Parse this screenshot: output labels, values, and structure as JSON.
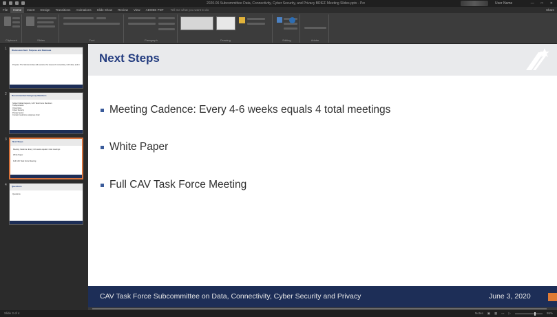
{
  "window": {
    "document_title": "2020-06 Subcommittee Data, Connectivity, Cyber Security, and Privacy BRIEF Meeting Slides.pptx - PowerPoint",
    "user_name": "User Name",
    "controls": [
      "—",
      "□",
      "✕"
    ]
  },
  "ribbon": {
    "tabs": [
      "File",
      "Home",
      "Insert",
      "Design",
      "Transitions",
      "Animations",
      "Slide Show",
      "Review",
      "View",
      "ADOBE PDF"
    ],
    "active_tab": "Home",
    "search_hint": "Tell me what you want to do",
    "share_label": "Share",
    "groups": [
      "Clipboard",
      "Slides",
      "Font",
      "Paragraph",
      "Drawing",
      "Editing",
      "Adobe"
    ]
  },
  "thumbnails": [
    {
      "number": "1",
      "title": "Discussion Item: Purpose and Rationale",
      "lines": [
        "Purpose: The Subcommittee will examine the issues of connectivity, CAV data, and information, and cyber security and data privacy."
      ]
    },
    {
      "number": "2",
      "title": "Recommended Subgroup Members",
      "lines": [
        "Subject Matter Experts, CAV Task Force Members",
        "Transportation",
        "Universities",
        "Cyber Security",
        "Private Sector",
        "Contact: task-force subgroup chair"
      ]
    },
    {
      "number": "3",
      "title": "Next Steps",
      "lines": [
        "Meeting Cadence: Every 4-6 weeks equals 4 total meetings",
        "White Paper",
        "Full CAV Task Force Meeting"
      ]
    },
    {
      "number": "4",
      "title": "Questions",
      "lines": [
        "Questions"
      ]
    }
  ],
  "slide": {
    "title": "Next Steps",
    "bullets": [
      "Meeting Cadence:  Every 4-6 weeks equals 4 total meetings",
      "White Paper",
      "Full CAV Task Force Meeting"
    ],
    "footer_text": "CAV Task Force Subcommittee on Data, Connectivity, Cyber Security and Privacy",
    "footer_date": "June 3, 2020",
    "colors": {
      "title": "#243d80",
      "header_bg": "#e9eaec",
      "footer_bg": "#1d2e57",
      "accent": "#e07b35"
    }
  },
  "status": {
    "slide_indicator": "Slide 3 of 4",
    "notes_label": "Notes",
    "zoom": "95%"
  }
}
